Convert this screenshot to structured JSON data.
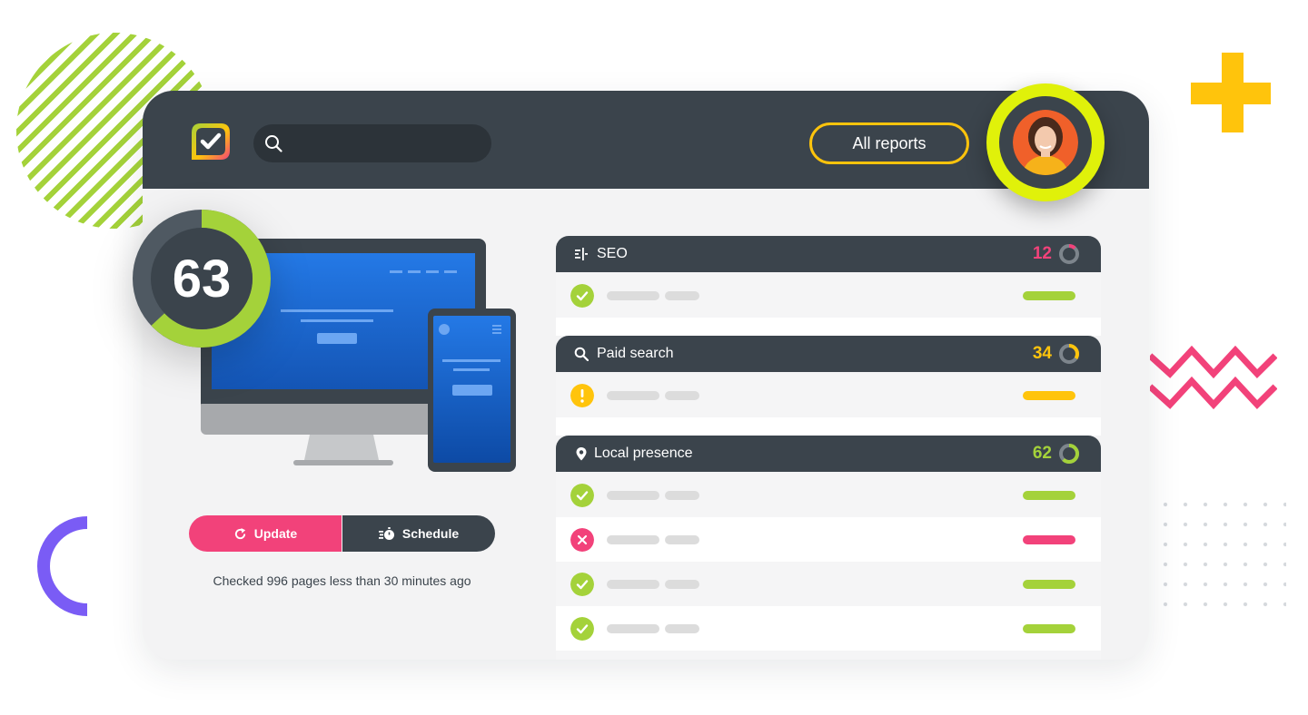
{
  "app": {
    "search_placeholder": ""
  },
  "header": {
    "all_reports_label": "All reports"
  },
  "overview": {
    "score": "63",
    "score_fraction": 0.63,
    "update_label": "Update",
    "schedule_label": "Schedule",
    "checked_text": "Checked 996 pages less than 30 minutes ago"
  },
  "colors": {
    "dark": "#3b444c",
    "green": "#a4d23a",
    "yellow": "#ffc40c",
    "red": "#f2427a",
    "lime": "#e0f10a"
  },
  "panels": [
    {
      "title": "SEO",
      "icon": "seo-icon",
      "score": "12",
      "score_fraction": 0.12,
      "color": "#f2427a",
      "rows": [
        {
          "status": "success"
        }
      ]
    },
    {
      "title": "Paid search",
      "icon": "search-icon",
      "score": "34",
      "score_fraction": 0.34,
      "color": "#ffc40c",
      "rows": [
        {
          "status": "warning"
        }
      ]
    },
    {
      "title": "Local presence",
      "icon": "location-pin-icon",
      "score": "62",
      "score_fraction": 0.62,
      "color": "#a4d23a",
      "rows": [
        {
          "status": "success"
        },
        {
          "status": "error"
        },
        {
          "status": "success"
        },
        {
          "status": "success"
        }
      ]
    }
  ]
}
